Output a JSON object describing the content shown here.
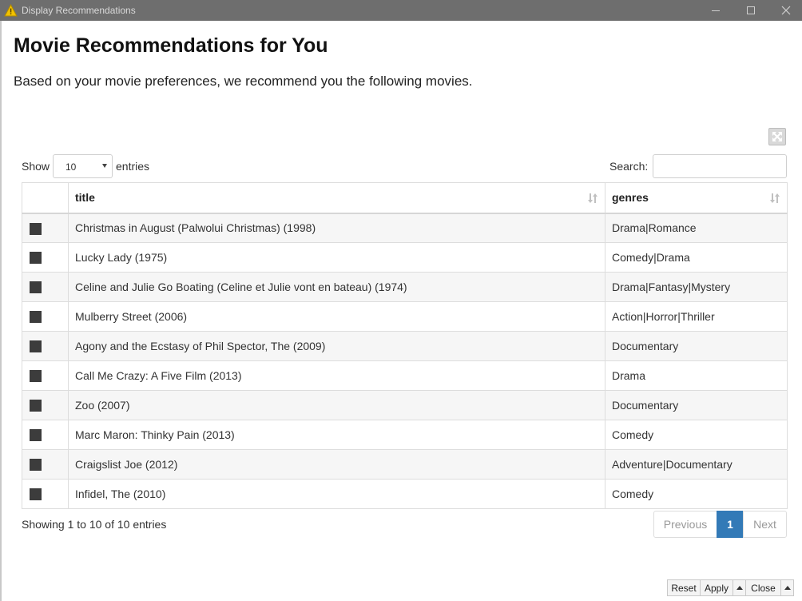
{
  "window": {
    "title": "Display Recommendations"
  },
  "page": {
    "heading": "Movie Recommendations for You",
    "subtext": "Based on your movie preferences, we recommend you the following movies."
  },
  "length_control": {
    "show_label": "Show",
    "selected": "10",
    "entries_label": "entries"
  },
  "search": {
    "label": "Search:",
    "value": ""
  },
  "table": {
    "columns": [
      "title",
      "genres"
    ],
    "rows": [
      {
        "title": "Christmas in August (Palwolui Christmas) (1998)",
        "genres": "Drama|Romance"
      },
      {
        "title": "Lucky Lady (1975)",
        "genres": "Comedy|Drama"
      },
      {
        "title": "Celine and Julie Go Boating (Celine et Julie vont en bateau) (1974)",
        "genres": "Drama|Fantasy|Mystery"
      },
      {
        "title": "Mulberry Street (2006)",
        "genres": "Action|Horror|Thriller"
      },
      {
        "title": "Agony and the Ecstasy of Phil Spector, The (2009)",
        "genres": "Documentary"
      },
      {
        "title": "Call Me Crazy: A Five Film (2013)",
        "genres": "Drama"
      },
      {
        "title": "Zoo (2007)",
        "genres": "Documentary"
      },
      {
        "title": "Marc Maron: Thinky Pain (2013)",
        "genres": "Comedy"
      },
      {
        "title": "Craigslist Joe (2012)",
        "genres": "Adventure|Documentary"
      },
      {
        "title": "Infidel, The (2010)",
        "genres": "Comedy"
      }
    ]
  },
  "info": "Showing 1 to 10 of 10 entries",
  "pagination": {
    "previous": "Previous",
    "current": "1",
    "next": "Next"
  },
  "footer": {
    "reset": "Reset",
    "apply": "Apply",
    "close": "Close"
  },
  "colors": {
    "titlebar": "#6e6e6e",
    "accent": "#337ab7",
    "row_alt": "#f6f6f6",
    "checkbox": "#3c3c3c"
  }
}
